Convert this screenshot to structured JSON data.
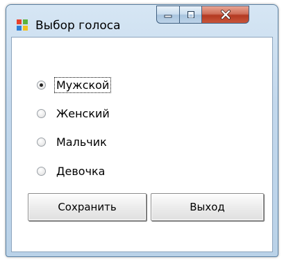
{
  "window": {
    "title": "Выбор голоса",
    "icon": "app-icon"
  },
  "caption_buttons": {
    "minimize_icon": "minimize-icon",
    "maximize_icon": "maximize-icon",
    "close_icon": "close-icon"
  },
  "voice_options": [
    {
      "label": "Мужской",
      "checked": true
    },
    {
      "label": "Женский",
      "checked": false
    },
    {
      "label": "Мальчик",
      "checked": false
    },
    {
      "label": "Девочка",
      "checked": false
    }
  ],
  "buttons": {
    "save_label": "Сохранить",
    "exit_label": "Выход"
  },
  "colors": {
    "titlebar": "#c3d8ec",
    "close_button": "#c8553a"
  }
}
